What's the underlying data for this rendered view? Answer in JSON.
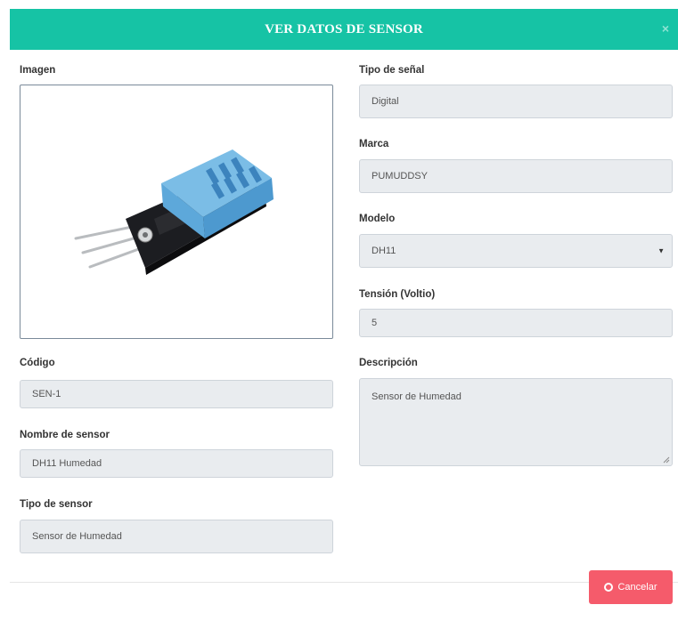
{
  "modal": {
    "title": "VER DATOS DE SENSOR",
    "close_symbol": "×"
  },
  "left": {
    "imagen_label": "Imagen",
    "codigo_label": "Código",
    "codigo_value": "SEN-1",
    "nombre_label": "Nombre de sensor",
    "nombre_value": "DH11 Humedad",
    "tipo_sensor_label": "Tipo de sensor",
    "tipo_sensor_value": "Sensor de Humedad"
  },
  "right": {
    "tipo_senal_label": "Tipo de señal",
    "tipo_senal_value": "Digital",
    "marca_label": "Marca",
    "marca_value": "PUMUDDSY",
    "modelo_label": "Modelo",
    "modelo_value": "DH11",
    "tension_label": "Tensión (Voltio)",
    "tension_value": "5",
    "descripcion_label": "Descripción",
    "descripcion_value": "Sensor de Humedad"
  },
  "footer": {
    "cancel_label": "Cancelar"
  },
  "colors": {
    "header": "#16c3a5",
    "cancel": "#f55b6b",
    "field_bg": "#e9ecef"
  },
  "icons": {
    "close": "close-icon",
    "cancel": "circle-icon",
    "select": "caret-down-icon"
  }
}
